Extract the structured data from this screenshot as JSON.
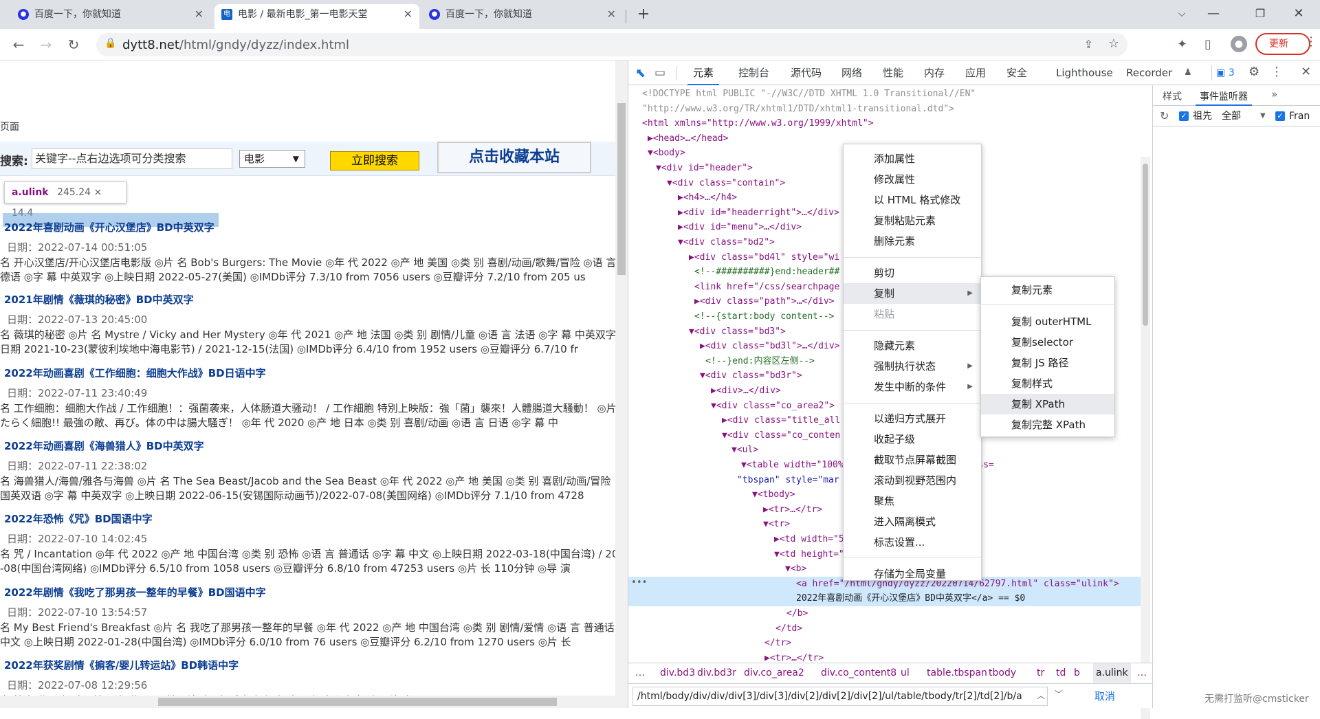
{
  "browser": {
    "tabs": [
      {
        "title": "百度一下，你就知道",
        "icon": "baidu-paw-icon"
      },
      {
        "title": "电影 / 最新电影_第一电影天堂",
        "icon": "dytt-logo-icon"
      },
      {
        "title": "百度一下，你就知道",
        "icon": "baidu-paw-icon"
      }
    ],
    "new_tab": "+",
    "url_host": "dytt8.net",
    "url_path": "/html/gndy/dyzz/index.html",
    "update_label": "更新"
  },
  "page": {
    "left_link": "页面",
    "search_label": "搜索:",
    "search_value": "关键字--点右边选项可分类搜索",
    "search_category": "电影",
    "search_button": "立即搜索",
    "favorite_button": "点击收藏本站",
    "tooltip_tag": "a.ulink",
    "tooltip_size": "245.24 × 14.4",
    "movies": [
      {
        "title": "2022年喜剧动画《开心汉堡店》BD中英双字",
        "date": "日期：2022-07-14 00:51:05",
        "line1": "名 开心汉堡店/开心汉堡店电影版 ◎片 名 Bob's Burgers: The Movie ◎年 代 2022 ◎产 地 美国 ◎类 别 喜剧/动画/歌舞/冒险 ◎语 言",
        "line2": "德语 ◎字 幕 中英双字 ◎上映日期 2022-05-27(美国) ◎IMDb评分 7.3/10 from 7056 users ◎豆瓣评分 7.2/10 from 205 us"
      },
      {
        "title": "2021年剧情《薇琪的秘密》BD中英双字",
        "date": "日期：2022-07-13 20:45:00",
        "line1": "名 薇琪的秘密 ◎片 名 Mystre / Vicky and Her Mystery ◎年 代 2021 ◎产 地 法国 ◎类 别 剧情/儿童 ◎语 言 法语 ◎字 幕 中英双字 ◎",
        "line2": "日期 2021-10-23(蒙彼利埃地中海电影节) / 2021-12-15(法国) ◎IMDb评分 6.4/10 from 1952 users ◎豆瓣评分 6.7/10 fr"
      },
      {
        "title": "2022年动画喜剧《工作细胞：细胞大作战》BD日语中字",
        "date": "日期：2022-07-11 23:40:49",
        "line1": "名 工作细胞：细胞大作战 / 工作细胞！：强菌袭来，人体肠道大骚动！ / 工作細胞 特別上映版：強「菌」襲來！人體腸道大騷動！ ◎片",
        "line2": "たらく細胞!! 最強の敵、再び。体の中は腸大騒ぎ！ ◎年 代 2020 ◎产 地 日本 ◎类 别 喜剧/动画 ◎语 言 日语 ◎字 幕 中"
      },
      {
        "title": "2022年动画喜剧《海兽猎人》BD中英双字",
        "date": "日期：2022-07-11 22:38:02",
        "line1": "名 海兽猎人/海兽/雅各与海兽 ◎片 名 The Sea Beast/Jacob and the Sea Beast ◎年 代 2022 ◎产 地 美国 ◎类 别 喜剧/动画/冒险",
        "line2": "国英双语 ◎字 幕 中英双字 ◎上映日期 2022-06-15(安锡国际动画节)/2022-07-08(美国网络) ◎IMDb评分 7.1/10 from 4728"
      },
      {
        "title": "2022年恐怖《咒》BD国语中字",
        "date": "日期：2022-07-10 14:02:45",
        "line1": "名 咒 / Incantation ◎年 代 2022 ◎产 地 中国台湾 ◎类 别 恐怖 ◎语 言 普通话 ◎字 幕 中文 ◎上映日期 2022-03-18(中国台湾) / 202",
        "line2": "-08(中国台湾网络) ◎IMDb评分 6.5/10 from 1058 users ◎豆瓣评分 6.8/10 from 47253 users ◎片 长 110分钟 ◎导 演"
      },
      {
        "title": "2022年剧情《我吃了那男孩一整年的早餐》BD国语中字",
        "date": "日期：2022-07-10 13:54:57",
        "line1": "名 My Best Friend's Breakfast ◎片 名 我吃了那男孩一整年的早餐 ◎年 代 2022 ◎产 地 中国台湾 ◎类 别 剧情/爱情 ◎语 言 普通话",
        "line2": "中文 ◎上映日期 2022-01-28(中国台湾) ◎IMDb评分 6.0/10 from 76 users ◎豆瓣评分 6.2/10 from 1270 users ◎片 长"
      },
      {
        "title": "2022年获奖剧情《掮客/婴儿转运站》BD韩语中字",
        "date": "日期：2022-07-08 12:29:56",
        "line1": "名 掮客/代理人/孩子转运站(港)/婴儿转运站(台)/经手人/经纪人/中间人/中介人/摆渡 ◎片 名 Baby Broker/Baby, Box, Broker/Brok",
        "line2": ""
      }
    ]
  },
  "devtools": {
    "tabs": [
      "元素",
      "控制台",
      "源代码",
      "网络",
      "性能",
      "内存",
      "应用",
      "安全",
      "Lighthouse",
      "Recorder"
    ],
    "selected_tab": "元素",
    "issues_count": "3",
    "side_tabs": [
      "样式",
      "事件监听器"
    ],
    "side_selected": "事件监听器",
    "ancestors_label": "祖先",
    "all_label": "全部",
    "framework_label": "Fran",
    "dom_lines": [
      "<!DOCTYPE html PUBLIC \"-//W3C//DTD XHTML 1.0 Transitional//EN\"",
      "\"http://www.w3.org/TR/xhtml1/DTD/xhtml1-transitional.dtd\">",
      "<html xmlns=\"http://www.w3.org/1999/xhtml\">",
      "▶<head>…</head>",
      "▼<body>",
      "▼<div id=\"header\">",
      "▼<div class=\"contain\">",
      "▶<h4>…</h4>",
      "▶<div id=\"headerright\">…</div>",
      "▶<div id=\"menu\">…</div>",
      "▼<div class=\"bd2\">",
      "▶<div class=\"bd4l\" style=\"wi",
      "<!--##########}end:header##",
      "<link href=\"/css/searchpage",
      "▶<div class=\"path\">…</div>",
      "<!--{start:body content-->",
      "▼<div class=\"bd3\">",
      "▶<div class=\"bd3l\">…</div>",
      "<!--}end:内容区左侧-->",
      "▼<div class=\"bd3r\">",
      "▶<div>…</div>",
      "▼<div class=\"co_area2\">",
      "▶<div class=\"title_all",
      "▼<div class=\"co_conten",
      "▼<ul>",
      "▼<table width=\"100%\"              \"0\" cellpadding=\"0\" class=",
      "\"tbspan\" style=\"mar",
      "▼<tbody>",
      "▶<tr>…</tr>",
      "▼<tr>",
      "▶<td width=\"5                        ter\">…</td>",
      "▼<td height=\"",
      "▼<b>",
      "<a href=\"/html/gndy/dyzz/20220714/62797.html\" class=\"ulink\">",
      "2022年喜剧动画《开心汉堡店》BD中英双字</a> == $0",
      "</b>",
      "</td>",
      "</tr>",
      "▶<tr>…</tr>"
    ],
    "breadcrumbs": [
      "…",
      "div.bd3",
      "div.bd3r",
      "div.co_area2",
      "div.co_content8",
      "ul",
      "table.tbspan",
      "tbody",
      "tr",
      "td",
      "b",
      "a.ulink",
      "…"
    ],
    "xpath_value": "/html/body/div/div/div[3]/div[3]/div[2]/div[2]/div[2]/ul/table/tbody/tr[2]/td[2]/b/a",
    "cancel_label": "取消"
  },
  "context_menu": {
    "items": [
      "添加属性",
      "修改属性",
      "以 HTML 格式修改",
      "复制粘贴元素",
      "删除元素",
      "剪切",
      "复制",
      "粘贴",
      "隐藏元素",
      "强制执行状态",
      "发生中断的条件",
      "以递归方式展开",
      "收起子级",
      "截取节点屏幕截图",
      "滚动到视野范围内",
      "聚焦",
      "进入隔离模式",
      "标志设置...",
      "存储为全局变量"
    ]
  },
  "copy_submenu": {
    "items": [
      "复制元素",
      "复制 outerHTML",
      "复制selector",
      "复制 JS 路径",
      "复制样式",
      "复制 XPath",
      "复制完整 XPath"
    ],
    "active": "复制 XPath"
  },
  "watermark": "无需打监听@cmsticker",
  "colors": {
    "highlight_row": "#cfe8fc",
    "devtools_accent": "#1a73e8",
    "update_red": "#d93025",
    "search_button": "#ffd800"
  }
}
